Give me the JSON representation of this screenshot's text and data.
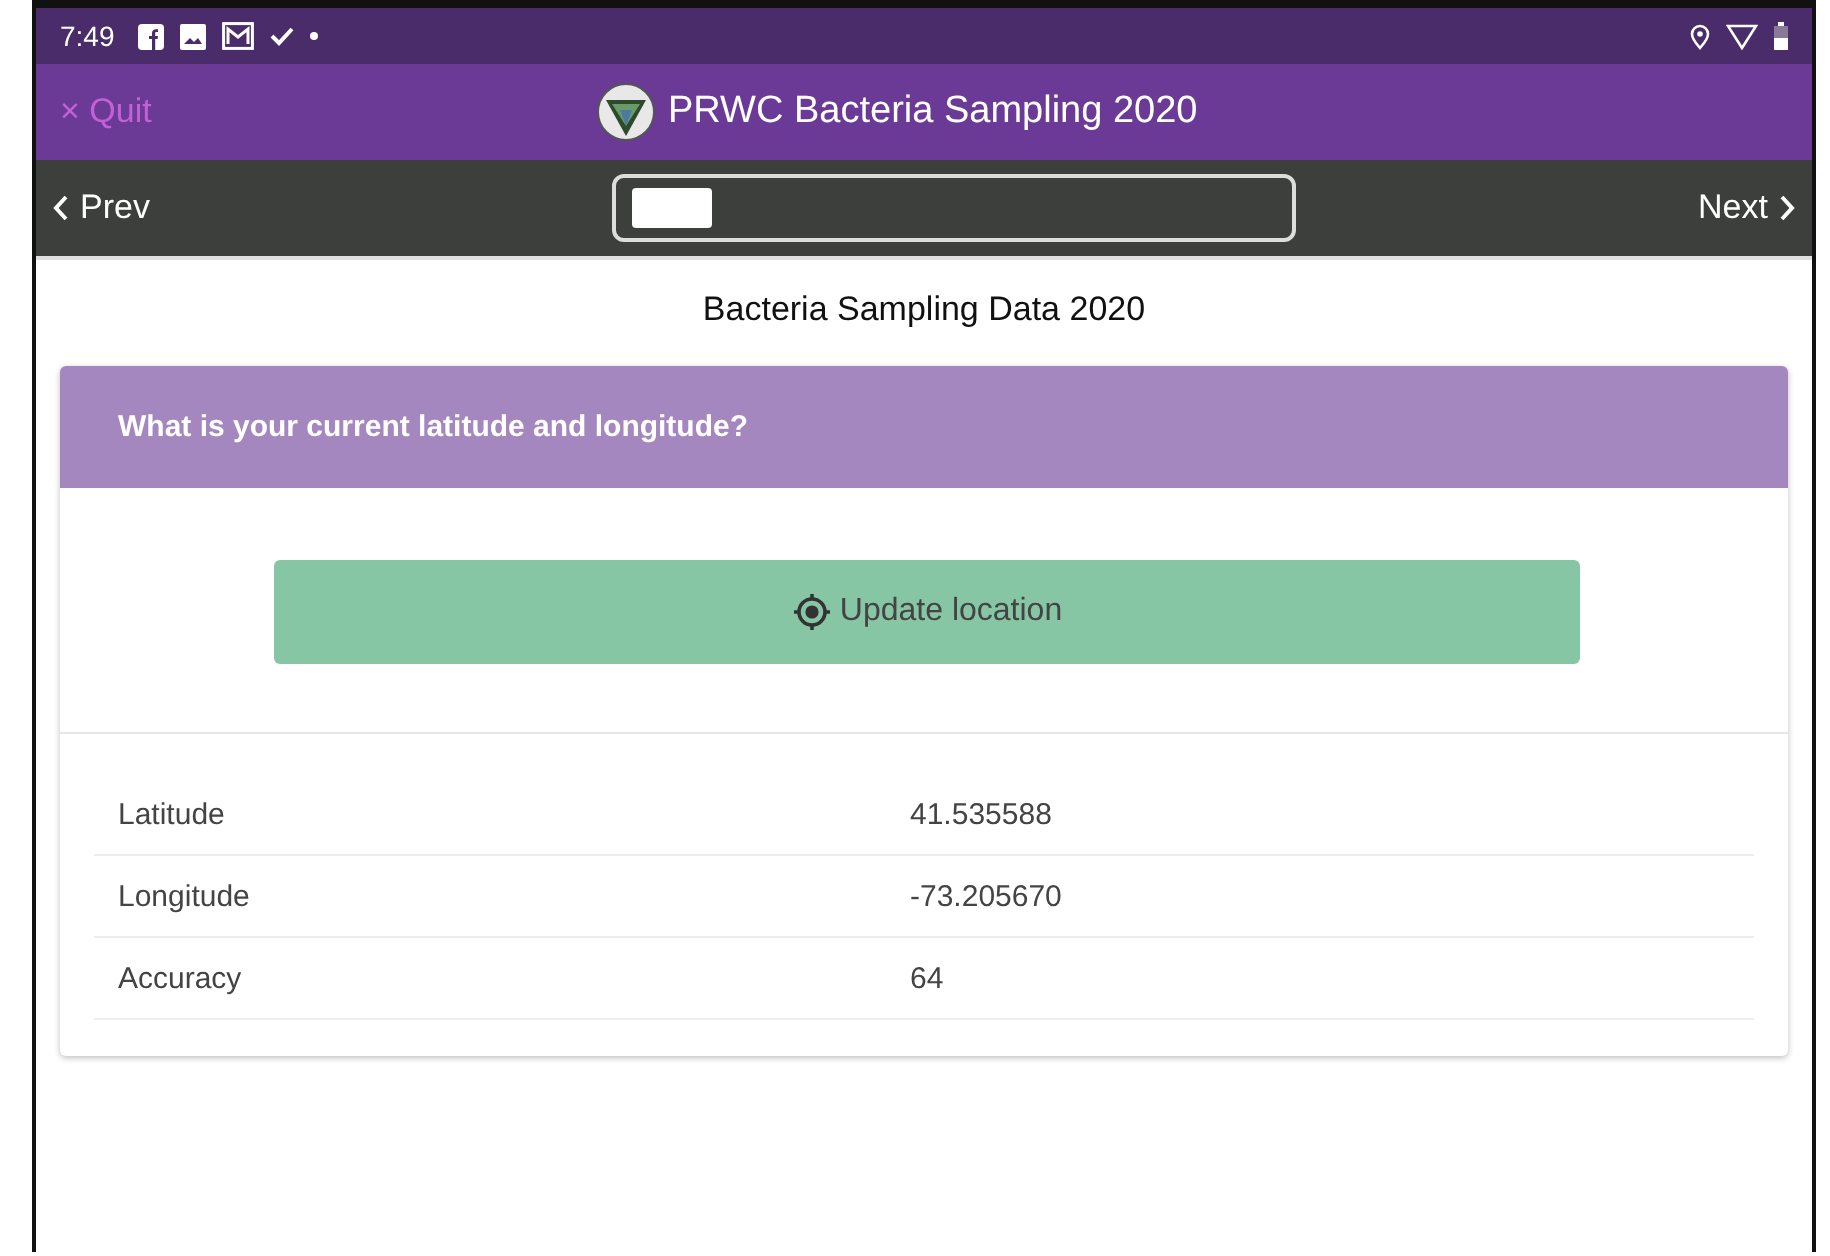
{
  "status_bar": {
    "time": "7:49"
  },
  "app_bar": {
    "quit": "× Quit",
    "title": "PRWC Bacteria Sampling 2020"
  },
  "nav_bar": {
    "prev": "Prev",
    "next": "Next"
  },
  "form": {
    "title": "Bacteria Sampling Data 2020",
    "question": "What is your current latitude and longitude?",
    "button": "Update location",
    "rows": [
      {
        "label": "Latitude",
        "value": "41.535588"
      },
      {
        "label": "Longitude",
        "value": "-73.205670"
      },
      {
        "label": "Accuracy",
        "value": "64"
      }
    ]
  }
}
